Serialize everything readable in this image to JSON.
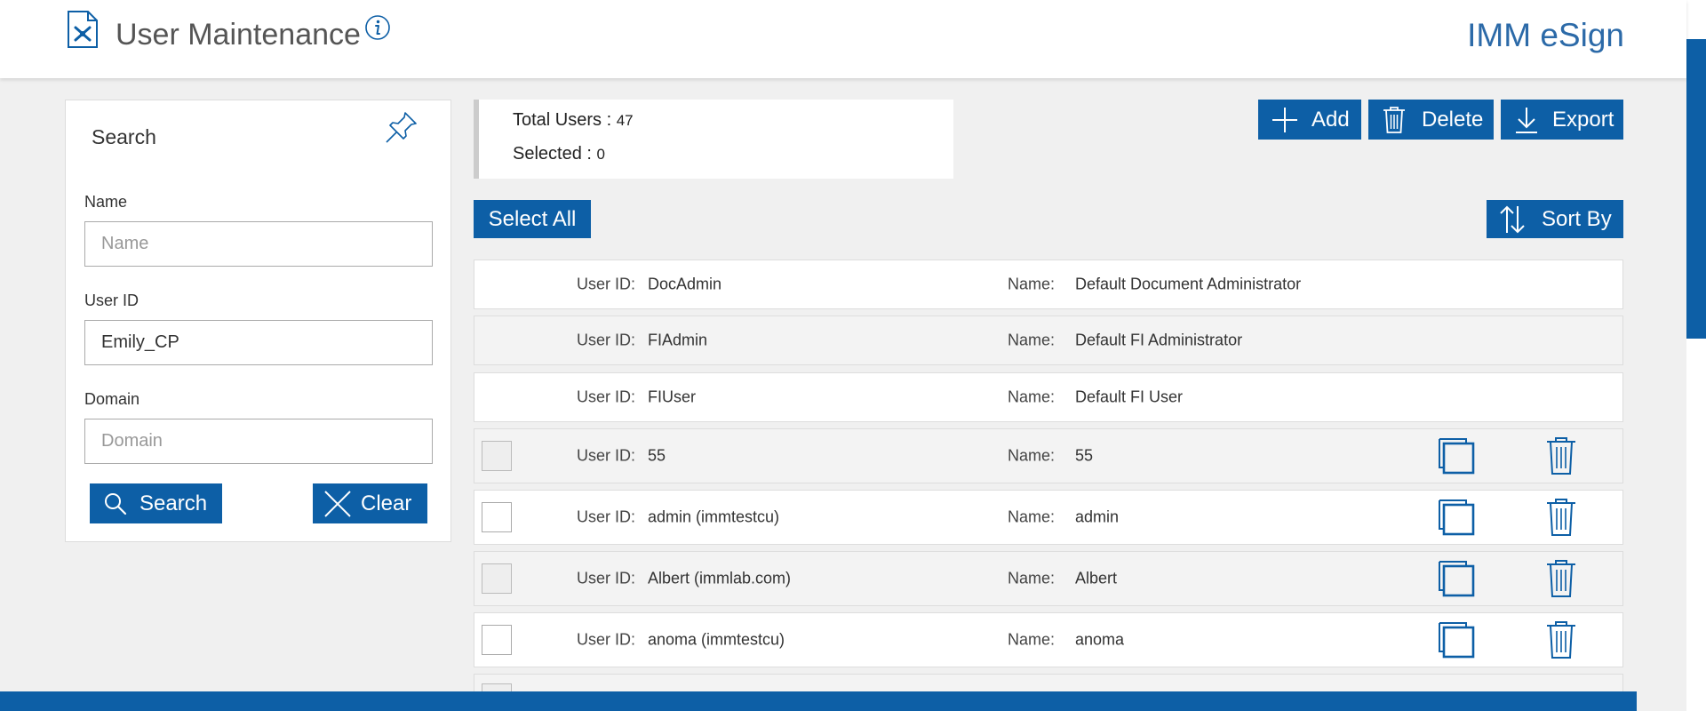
{
  "header": {
    "title": "User Maintenance",
    "brand": "IMM eSign"
  },
  "search_panel": {
    "title": "Search",
    "fields": [
      {
        "label": "Name",
        "placeholder": "Name",
        "value": ""
      },
      {
        "label": "User ID",
        "placeholder": "User ID",
        "value": "Emily_CP"
      },
      {
        "label": "Domain",
        "placeholder": "Domain",
        "value": ""
      }
    ],
    "search_label": "Search",
    "clear_label": "Clear"
  },
  "summary": {
    "total_label": "Total Users : ",
    "total_value": "47",
    "selected_label": "Selected : ",
    "selected_value": "0"
  },
  "toolbar": {
    "add_label": "Add",
    "delete_label": "Delete",
    "export_label": "Export",
    "select_all_label": "Select All",
    "sort_by_label": "Sort By"
  },
  "list": {
    "user_id_label": "User ID:",
    "name_label": "Name:",
    "rows": [
      {
        "user_id": "DocAdmin",
        "name": "Default Document Administrator"
      },
      {
        "user_id": "FIAdmin",
        "name": "Default FI Administrator"
      },
      {
        "user_id": "FIUser",
        "name": "Default FI User"
      },
      {
        "user_id": "55",
        "name": "55"
      },
      {
        "user_id": "admin (immtestcu)",
        "name": "admin"
      },
      {
        "user_id": "Albert (immlab.com)",
        "name": "Albert"
      },
      {
        "user_id": "anoma (immtestcu)",
        "name": "anoma"
      }
    ]
  },
  "colors": {
    "primary": "#0d5fa6",
    "brand_text": "#2c6aa8",
    "background": "#f0f0f0"
  },
  "icons": [
    "app-tools-icon",
    "info-icon",
    "pin-icon",
    "search-icon",
    "close-icon",
    "plus-icon",
    "trash-icon",
    "download-icon",
    "sort-icon",
    "copy-icon"
  ]
}
